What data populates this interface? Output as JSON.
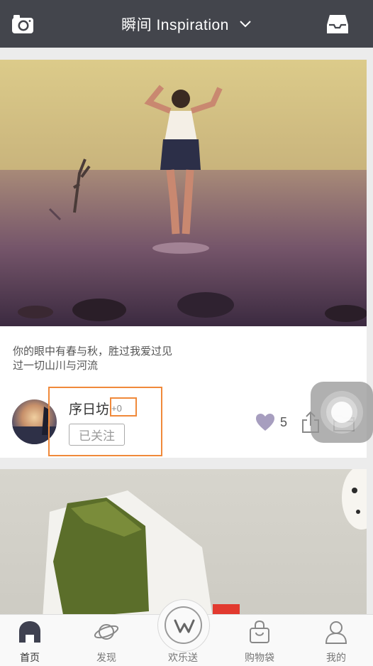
{
  "header": {
    "title": "瞬间 Inspiration"
  },
  "post": {
    "caption_line1": "你的眼中有春与秋，胜过我爱过见",
    "caption_line2": "过一切山川与河流",
    "username": "序日坊",
    "plus": "+0",
    "follow_label": "已关注",
    "likes": "5"
  },
  "tabs": [
    {
      "label": "首页",
      "icon": "home-icon",
      "active": true
    },
    {
      "label": "发现",
      "icon": "planet-icon",
      "active": false
    },
    {
      "label": "欢乐送",
      "icon": "w-logo-icon",
      "active": false
    },
    {
      "label": "购物袋",
      "icon": "bag-icon",
      "active": false
    },
    {
      "label": "我的",
      "icon": "person-icon",
      "active": false
    }
  ],
  "colors": {
    "topbar": "#43454c",
    "highlight": "#f0893a",
    "heart": "#a79ebf"
  }
}
